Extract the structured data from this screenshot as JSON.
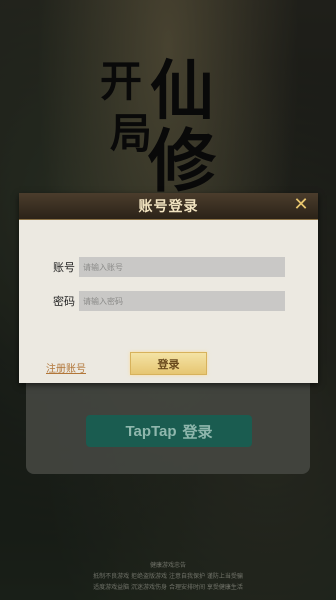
{
  "background": {
    "game_title": [
      "开",
      "仙",
      "局",
      "修"
    ]
  },
  "under_panel": {
    "taptap_logo": "TapTap",
    "taptap_suffix": "登录"
  },
  "modal": {
    "title": "账号登录",
    "close_icon": "✕",
    "account_label": "账号",
    "account_placeholder": "请输入账号",
    "password_label": "密码",
    "password_placeholder": "请输入密码",
    "register_link": "注册账号",
    "login_button": "登录"
  },
  "footer": {
    "line1": "健康游戏忠告",
    "line2": "抵制不良游戏 拒绝盗版游戏 注意自我保护 谨防上当受骗",
    "line3": "适度游戏益脑 沉迷游戏伤身 合理安排时间 享受健康生活"
  },
  "colors": {
    "modal_header": "#3a2f22",
    "modal_body": "#ece9e1",
    "accent_gold": "#e9c76f",
    "taptap_green": "#1a5c50"
  }
}
